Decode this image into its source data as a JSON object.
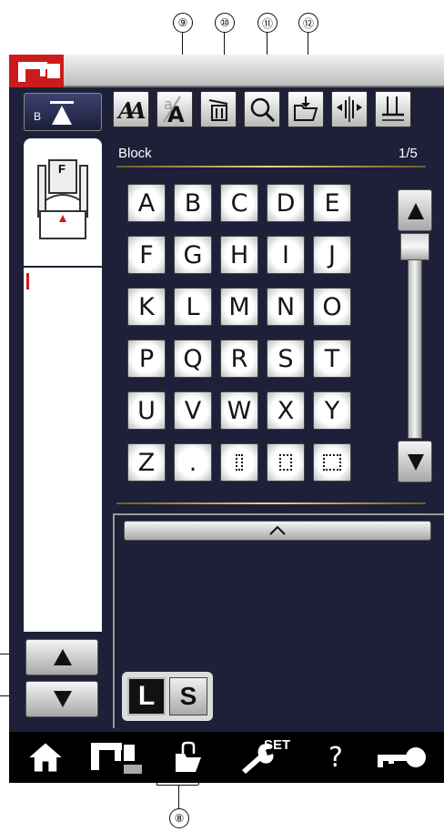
{
  "callouts": {
    "c8": "⑧",
    "c9": "⑨",
    "c10": "⑩",
    "c11": "⑪",
    "c12": "⑫"
  },
  "icons": {
    "machine": "machine-icon",
    "needle": "needle-position-icon",
    "foot": "presser-foot-icon",
    "tools": [
      "font-style-icon",
      "case-toggle-icon",
      "delete-icon",
      "zoom-icon",
      "save-file-icon",
      "mirror-icon",
      "stitch-adjust-icon"
    ],
    "bottom": [
      "home-icon",
      "sewing-mode-icon",
      "open-file-icon",
      "set-wrench-icon",
      "help-icon",
      "key-lock-icon"
    ]
  },
  "needle_label": "B",
  "foot_label": "F",
  "category": "Block",
  "page": "1/5",
  "keys": [
    [
      "A",
      "B",
      "C",
      "D",
      "E"
    ],
    [
      "F",
      "G",
      "H",
      "I",
      "J"
    ],
    [
      "K",
      "L",
      "M",
      "N",
      "O"
    ],
    [
      "P",
      "Q",
      "R",
      "S",
      "T"
    ],
    [
      "U",
      "V",
      "W",
      "X",
      "Y"
    ],
    [
      "Z",
      ".",
      "",
      "",
      ""
    ]
  ],
  "size_buttons": {
    "large": "L",
    "small": "S",
    "selected": "L"
  },
  "bottom_labels": {
    "set": "SET",
    "help": "?"
  },
  "colors": {
    "screen_bg": "#1e1f38",
    "accent_red": "#cc1b1b",
    "gold": "#e8d38a"
  }
}
